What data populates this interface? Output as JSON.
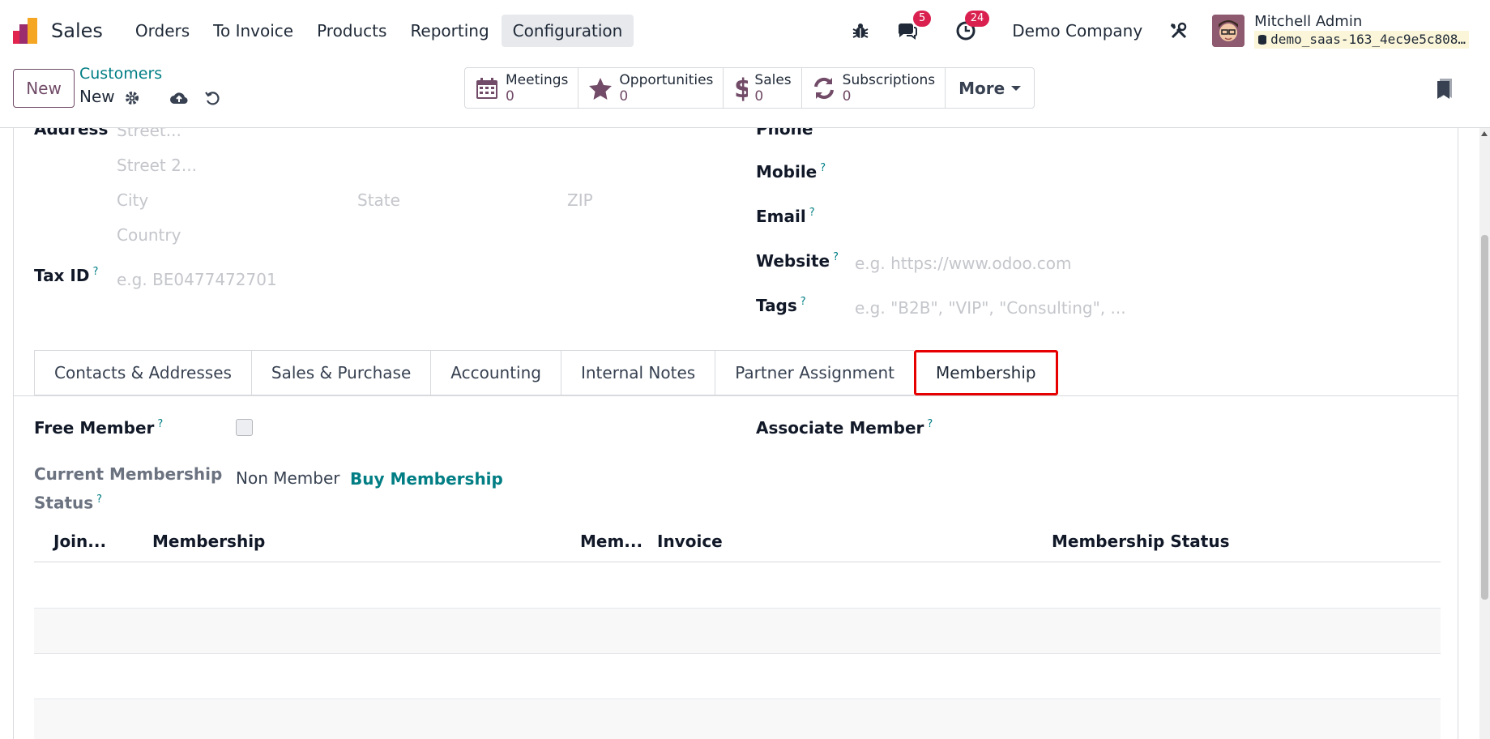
{
  "navbar": {
    "app_name": "Sales",
    "menu": [
      "Orders",
      "To Invoice",
      "Products",
      "Reporting",
      "Configuration"
    ],
    "active_menu": "Configuration",
    "messages_badge": "5",
    "activities_badge": "24",
    "company": "Demo Company",
    "user_name": "Mitchell Admin",
    "db_name": "demo_saas-163_4ec9e5c808…"
  },
  "control": {
    "new_label": "New",
    "breadcrumb": "Customers",
    "record_name": "New",
    "smart_buttons": [
      {
        "label": "Meetings",
        "count": "0",
        "icon": "calendar-icon"
      },
      {
        "label": "Opportunities",
        "count": "0",
        "icon": "star-icon"
      },
      {
        "label": "Sales",
        "count": "0",
        "icon": "dollar-icon"
      },
      {
        "label": "Subscriptions",
        "count": "0",
        "icon": "refresh-icon"
      }
    ],
    "more_label": "More"
  },
  "form": {
    "address_label": "Address",
    "street_ph": "Street...",
    "street2_ph": "Street 2...",
    "city_ph": "City",
    "state_ph": "State",
    "zip_ph": "ZIP",
    "country_ph": "Country",
    "tax_label": "Tax ID",
    "tax_ph": "e.g. BE0477472701",
    "phone_label": "Phone",
    "mobile_label": "Mobile",
    "email_label": "Email",
    "website_label": "Website",
    "website_ph": "e.g. https://www.odoo.com",
    "tags_label": "Tags",
    "tags_ph": "e.g. \"B2B\", \"VIP\", \"Consulting\", ...",
    "tooltip_mark": "?"
  },
  "tabs": [
    "Contacts & Addresses",
    "Sales & Purchase",
    "Accounting",
    "Internal Notes",
    "Partner Assignment",
    "Membership"
  ],
  "active_tab": "Membership",
  "membership": {
    "free_member_label": "Free Member",
    "free_member_checked": false,
    "associate_label": "Associate Member",
    "status_label_1": "Current Membership",
    "status_label_2": "Status",
    "status_value": "Non Member",
    "buy_label": "Buy Membership",
    "columns": [
      "Join...",
      "Membership",
      "Mem...",
      "Invoice",
      "Membership Status"
    ]
  },
  "colors": {
    "brand": "#714b67",
    "link": "#017e84",
    "highlight": "#e60000",
    "badge": "#d9204f"
  }
}
